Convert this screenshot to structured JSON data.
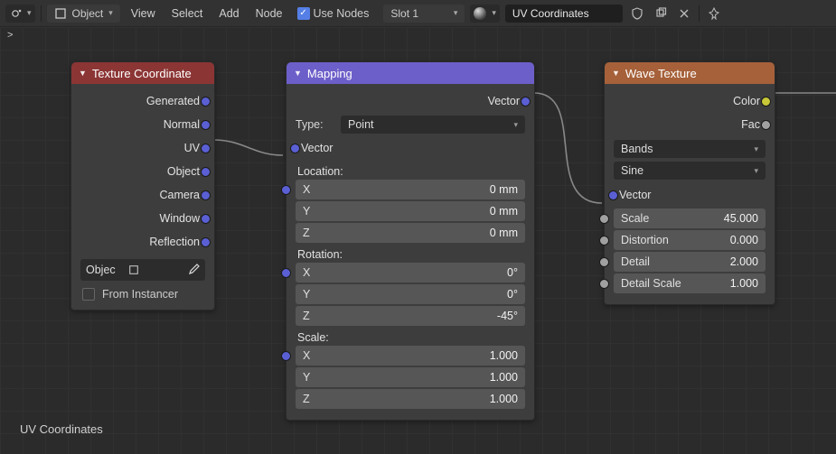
{
  "header": {
    "snap_dropdown": "",
    "mode_label": "Object",
    "menus": [
      "View",
      "Select",
      "Add",
      "Node"
    ],
    "use_nodes_label": "Use Nodes",
    "use_nodes_checked": true,
    "slot_label": "Slot 1",
    "material_name": "UV Coordinates",
    "pin_tooltip": ""
  },
  "breadcrumb": ">",
  "nodes": {
    "texcoord": {
      "title": "Texture Coordinate",
      "outputs": [
        "Generated",
        "Normal",
        "UV",
        "Object",
        "Camera",
        "Window",
        "Reflection"
      ],
      "object_label": "Objec",
      "from_instancer_label": "From Instancer"
    },
    "mapping": {
      "title": "Mapping",
      "output_label": "Vector",
      "type_label": "Type:",
      "type_value": "Point",
      "vector_input_label": "Vector",
      "groups": {
        "location": {
          "label": "Location:",
          "x": "0 mm",
          "y": "0 mm",
          "z": "0 mm"
        },
        "rotation": {
          "label": "Rotation:",
          "x": "0°",
          "y": "0°",
          "z": "-45°"
        },
        "scale": {
          "label": "Scale:",
          "x": "1.000",
          "y": "1.000",
          "z": "1.000"
        }
      },
      "axis": {
        "x": "X",
        "y": "Y",
        "z": "Z"
      }
    },
    "wave": {
      "title": "Wave Texture",
      "out_color": "Color",
      "out_fac": "Fac",
      "type_value": "Bands",
      "profile_value": "Sine",
      "vector_label": "Vector",
      "params": {
        "scale": {
          "label": "Scale",
          "value": "45.000"
        },
        "distortion": {
          "label": "Distortion",
          "value": "0.000"
        },
        "detail": {
          "label": "Detail",
          "value": "2.000"
        },
        "detail_scale": {
          "label": "Detail Scale",
          "value": "1.000"
        }
      }
    }
  },
  "status_text": "UV Coordinates",
  "colors": {
    "socket_vector": "#5a5fd3",
    "socket_color": "#c8c838",
    "socket_fac": "#a0a0a0"
  }
}
